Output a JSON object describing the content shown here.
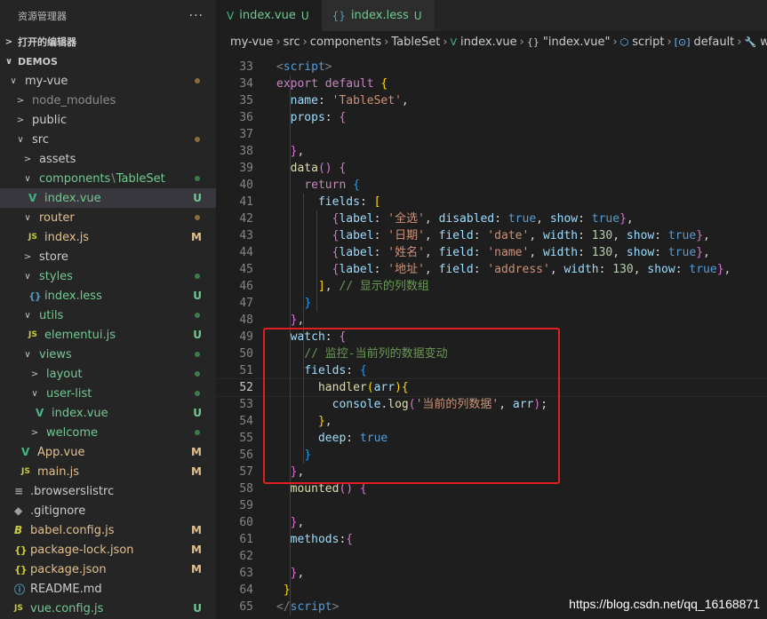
{
  "explorer": {
    "title": "资源管理器",
    "more": "···",
    "open_editors": "打开的编辑器",
    "workspace": "DEMOS"
  },
  "tree": [
    {
      "label": "my-vue",
      "chev": "∨",
      "indent": 0,
      "dot": "#8b6a3e",
      "color": "#cccccc"
    },
    {
      "label": "node_modules",
      "chev": ">",
      "indent": 1,
      "color": "#8c8c8c"
    },
    {
      "label": "public",
      "chev": ">",
      "indent": 1,
      "color": "#cccccc"
    },
    {
      "label": "src",
      "chev": "∨",
      "indent": 1,
      "dot": "#8b6a3e",
      "color": "#cccccc"
    },
    {
      "label": "assets",
      "chev": ">",
      "indent": 2,
      "color": "#cccccc"
    },
    {
      "label": "components",
      "label2": "TableSet",
      "chev": "∨",
      "indent": 2,
      "dot": "#3f7a4a",
      "color": "#73c991"
    },
    {
      "label": "index.vue",
      "icon": "vue",
      "indent": 3,
      "badge": "U",
      "badgeColor": "#73c991",
      "color": "#73c991",
      "active": true
    },
    {
      "label": "router",
      "chev": "∨",
      "indent": 2,
      "dot": "#8b6a3e",
      "color": "#e2c08d"
    },
    {
      "label": "index.js",
      "icon": "js",
      "indent": 3,
      "badge": "M",
      "badgeColor": "#e2c08d",
      "color": "#e2c08d"
    },
    {
      "label": "store",
      "chev": ">",
      "indent": 2,
      "color": "#cccccc"
    },
    {
      "label": "styles",
      "chev": "∨",
      "indent": 2,
      "dot": "#3f7a4a",
      "color": "#73c991"
    },
    {
      "label": "index.less",
      "icon": "less",
      "indent": 3,
      "badge": "U",
      "badgeColor": "#73c991",
      "color": "#73c991"
    },
    {
      "label": "utils",
      "chev": "∨",
      "indent": 2,
      "dot": "#3f7a4a",
      "color": "#73c991"
    },
    {
      "label": "elementui.js",
      "icon": "js",
      "indent": 3,
      "badge": "U",
      "badgeColor": "#73c991",
      "color": "#73c991"
    },
    {
      "label": "views",
      "chev": "∨",
      "indent": 2,
      "dot": "#3f7a4a",
      "color": "#73c991"
    },
    {
      "label": "layout",
      "chev": ">",
      "indent": 3,
      "dot": "#3f7a4a",
      "color": "#73c991"
    },
    {
      "label": "user-list",
      "chev": "∨",
      "indent": 3,
      "dot": "#3f7a4a",
      "color": "#73c991"
    },
    {
      "label": "index.vue",
      "icon": "vue",
      "indent": 4,
      "badge": "U",
      "badgeColor": "#73c991",
      "color": "#73c991"
    },
    {
      "label": "welcome",
      "chev": ">",
      "indent": 3,
      "dot": "#3f7a4a",
      "color": "#73c991"
    },
    {
      "label": "App.vue",
      "icon": "vue",
      "indent": 2,
      "badge": "M",
      "badgeColor": "#e2c08d",
      "color": "#e2c08d"
    },
    {
      "label": "main.js",
      "icon": "js",
      "indent": 2,
      "badge": "M",
      "badgeColor": "#e2c08d",
      "color": "#e2c08d"
    },
    {
      "label": ".browserslistrc",
      "icon": "lines",
      "indent": 1,
      "color": "#cccccc"
    },
    {
      "label": ".gitignore",
      "icon": "git",
      "indent": 1,
      "color": "#cccccc"
    },
    {
      "label": "babel.config.js",
      "icon": "babel",
      "indent": 1,
      "badge": "M",
      "badgeColor": "#e2c08d",
      "color": "#e2c08d"
    },
    {
      "label": "package-lock.json",
      "icon": "json",
      "indent": 1,
      "badge": "M",
      "badgeColor": "#e2c08d",
      "color": "#e2c08d"
    },
    {
      "label": "package.json",
      "icon": "json",
      "indent": 1,
      "badge": "M",
      "badgeColor": "#e2c08d",
      "color": "#e2c08d"
    },
    {
      "label": "README.md",
      "icon": "info",
      "indent": 1,
      "color": "#cccccc"
    },
    {
      "label": "vue.config.js",
      "icon": "js",
      "indent": 1,
      "badge": "U",
      "badgeColor": "#73c991",
      "color": "#73c991"
    }
  ],
  "tabs": [
    {
      "label": "index.vue",
      "status": "U",
      "icon": "V",
      "active": true
    },
    {
      "label": "index.less",
      "status": "U",
      "icon": "{}",
      "active": false
    }
  ],
  "breadcrumbs": [
    "my-vue",
    "src",
    "components",
    "TableSet",
    "index.vue",
    "\"index.vue\"",
    "script",
    "default",
    "w"
  ],
  "code_lines": [
    {
      "n": "33",
      "t": [
        [
          "tag",
          "<"
        ],
        [
          "tname",
          "script"
        ],
        [
          "tag",
          ">"
        ]
      ]
    },
    {
      "n": "34",
      "t": [
        [
          "kw",
          "export default "
        ],
        [
          "b1",
          "{"
        ]
      ]
    },
    {
      "n": "35",
      "t": [
        [
          "p",
          "  "
        ],
        [
          "prop",
          "name"
        ],
        [
          "p",
          ": "
        ],
        [
          "str",
          "'TableSet'"
        ],
        [
          "p",
          ","
        ]
      ]
    },
    {
      "n": "36",
      "t": [
        [
          "p",
          "  "
        ],
        [
          "prop",
          "props"
        ],
        [
          "p",
          ": "
        ],
        [
          "b2",
          "{"
        ]
      ]
    },
    {
      "n": "37",
      "t": []
    },
    {
      "n": "38",
      "t": [
        [
          "p",
          "  "
        ],
        [
          "b2",
          "}"
        ],
        [
          "p",
          ","
        ]
      ]
    },
    {
      "n": "39",
      "t": [
        [
          "p",
          "  "
        ],
        [
          "fn",
          "data"
        ],
        [
          "b2",
          "()"
        ],
        [
          "p",
          " "
        ],
        [
          "b2",
          "{"
        ]
      ]
    },
    {
      "n": "40",
      "t": [
        [
          "p",
          "    "
        ],
        [
          "kw",
          "return"
        ],
        [
          "p",
          " "
        ],
        [
          "b3",
          "{"
        ]
      ]
    },
    {
      "n": "41",
      "t": [
        [
          "p",
          "      "
        ],
        [
          "prop",
          "fields"
        ],
        [
          "p",
          ": "
        ],
        [
          "b1",
          "["
        ]
      ]
    },
    {
      "n": "42",
      "t": [
        [
          "p",
          "        "
        ],
        [
          "b2",
          "{"
        ],
        [
          "prop",
          "label"
        ],
        [
          "p",
          ": "
        ],
        [
          "str",
          "'全选'"
        ],
        [
          "p",
          ", "
        ],
        [
          "prop",
          "disabled"
        ],
        [
          "p",
          ": "
        ],
        [
          "bool",
          "true"
        ],
        [
          "p",
          ", "
        ],
        [
          "prop",
          "show"
        ],
        [
          "p",
          ": "
        ],
        [
          "bool",
          "true"
        ],
        [
          "b2",
          "}"
        ],
        [
          "p",
          ","
        ]
      ]
    },
    {
      "n": "43",
      "t": [
        [
          "p",
          "        "
        ],
        [
          "b2",
          "{"
        ],
        [
          "prop",
          "label"
        ],
        [
          "p",
          ": "
        ],
        [
          "str",
          "'日期'"
        ],
        [
          "p",
          ", "
        ],
        [
          "prop",
          "field"
        ],
        [
          "p",
          ": "
        ],
        [
          "str",
          "'date'"
        ],
        [
          "p",
          ", "
        ],
        [
          "prop",
          "width"
        ],
        [
          "p",
          ": "
        ],
        [
          "num",
          "130"
        ],
        [
          "p",
          ", "
        ],
        [
          "prop",
          "show"
        ],
        [
          "p",
          ": "
        ],
        [
          "bool",
          "true"
        ],
        [
          "b2",
          "}"
        ],
        [
          "p",
          ","
        ]
      ]
    },
    {
      "n": "44",
      "t": [
        [
          "p",
          "        "
        ],
        [
          "b2",
          "{"
        ],
        [
          "prop",
          "label"
        ],
        [
          "p",
          ": "
        ],
        [
          "str",
          "'姓名'"
        ],
        [
          "p",
          ", "
        ],
        [
          "prop",
          "field"
        ],
        [
          "p",
          ": "
        ],
        [
          "str",
          "'name'"
        ],
        [
          "p",
          ", "
        ],
        [
          "prop",
          "width"
        ],
        [
          "p",
          ": "
        ],
        [
          "num",
          "130"
        ],
        [
          "p",
          ", "
        ],
        [
          "prop",
          "show"
        ],
        [
          "p",
          ": "
        ],
        [
          "bool",
          "true"
        ],
        [
          "b2",
          "}"
        ],
        [
          "p",
          ","
        ]
      ]
    },
    {
      "n": "45",
      "t": [
        [
          "p",
          "        "
        ],
        [
          "b2",
          "{"
        ],
        [
          "prop",
          "label"
        ],
        [
          "p",
          ": "
        ],
        [
          "str",
          "'地址'"
        ],
        [
          "p",
          ", "
        ],
        [
          "prop",
          "field"
        ],
        [
          "p",
          ": "
        ],
        [
          "str",
          "'address'"
        ],
        [
          "p",
          ", "
        ],
        [
          "prop",
          "width"
        ],
        [
          "p",
          ": "
        ],
        [
          "num",
          "130"
        ],
        [
          "p",
          ", "
        ],
        [
          "prop",
          "show"
        ],
        [
          "p",
          ": "
        ],
        [
          "bool",
          "true"
        ],
        [
          "b2",
          "}"
        ],
        [
          "p",
          ","
        ]
      ]
    },
    {
      "n": "46",
      "t": [
        [
          "p",
          "      "
        ],
        [
          "b1",
          "]"
        ],
        [
          "p",
          ", "
        ],
        [
          "cmt",
          "// 显示的列数组"
        ]
      ]
    },
    {
      "n": "47",
      "t": [
        [
          "p",
          "    "
        ],
        [
          "b3",
          "}"
        ]
      ]
    },
    {
      "n": "48",
      "t": [
        [
          "p",
          "  "
        ],
        [
          "b2",
          "}"
        ],
        [
          "p",
          ","
        ]
      ]
    },
    {
      "n": "49",
      "t": [
        [
          "p",
          "  "
        ],
        [
          "prop",
          "watch"
        ],
        [
          "p",
          ": "
        ],
        [
          "b2",
          "{"
        ]
      ]
    },
    {
      "n": "50",
      "t": [
        [
          "p",
          "    "
        ],
        [
          "cmt",
          "// 监控-当前列的数据变动"
        ]
      ]
    },
    {
      "n": "51",
      "t": [
        [
          "p",
          "    "
        ],
        [
          "prop",
          "fields"
        ],
        [
          "p",
          ": "
        ],
        [
          "b3",
          "{"
        ]
      ]
    },
    {
      "n": "52",
      "t": [
        [
          "p",
          "      "
        ],
        [
          "fn",
          "handler"
        ],
        [
          "b1",
          "("
        ],
        [
          "prop",
          "arr"
        ],
        [
          "b1",
          "){"
        ]
      ]
    },
    {
      "n": "53",
      "t": [
        [
          "p",
          "        "
        ],
        [
          "prop",
          "console"
        ],
        [
          "p",
          "."
        ],
        [
          "fn",
          "log"
        ],
        [
          "b2",
          "("
        ],
        [
          "str",
          "'当前的列数据'"
        ],
        [
          "p",
          ", "
        ],
        [
          "prop",
          "arr"
        ],
        [
          "b2",
          ")"
        ],
        [
          "p",
          ";"
        ]
      ]
    },
    {
      "n": "54",
      "t": [
        [
          "p",
          "      "
        ],
        [
          "b1",
          "}"
        ],
        [
          "p",
          ","
        ]
      ]
    },
    {
      "n": "55",
      "t": [
        [
          "p",
          "      "
        ],
        [
          "prop",
          "deep"
        ],
        [
          "p",
          ": "
        ],
        [
          "bool",
          "true"
        ]
      ]
    },
    {
      "n": "56",
      "t": [
        [
          "p",
          "    "
        ],
        [
          "b3",
          "}"
        ]
      ]
    },
    {
      "n": "57",
      "t": [
        [
          "p",
          "  "
        ],
        [
          "b2",
          "}"
        ],
        [
          "p",
          ","
        ]
      ]
    },
    {
      "n": "58",
      "t": [
        [
          "p",
          "  "
        ],
        [
          "fn",
          "mounted"
        ],
        [
          "b2",
          "()"
        ],
        [
          "p",
          " "
        ],
        [
          "b2",
          "{"
        ]
      ]
    },
    {
      "n": "59",
      "t": []
    },
    {
      "n": "60",
      "t": [
        [
          "p",
          "  "
        ],
        [
          "b2",
          "}"
        ],
        [
          "p",
          ","
        ]
      ]
    },
    {
      "n": "61",
      "t": [
        [
          "p",
          "  "
        ],
        [
          "prop",
          "methods"
        ],
        [
          "p",
          ":"
        ],
        [
          "b2",
          "{"
        ]
      ]
    },
    {
      "n": "62",
      "t": []
    },
    {
      "n": "63",
      "t": [
        [
          "p",
          "  "
        ],
        [
          "b2",
          "}"
        ],
        [
          "p",
          ","
        ]
      ]
    },
    {
      "n": "64",
      "t": [
        [
          "p",
          " "
        ],
        [
          "b1",
          "}"
        ]
      ]
    },
    {
      "n": "65",
      "t": [
        [
          "tag",
          "</"
        ],
        [
          "tname",
          "script"
        ],
        [
          "tag",
          ">"
        ]
      ]
    }
  ],
  "current_line": "52",
  "watermark": "https://blog.csdn.net/qq_16168871",
  "colors": {
    "highlight_box": "#e02020",
    "git_untracked": "#73c991",
    "git_modified": "#e2c08d"
  }
}
